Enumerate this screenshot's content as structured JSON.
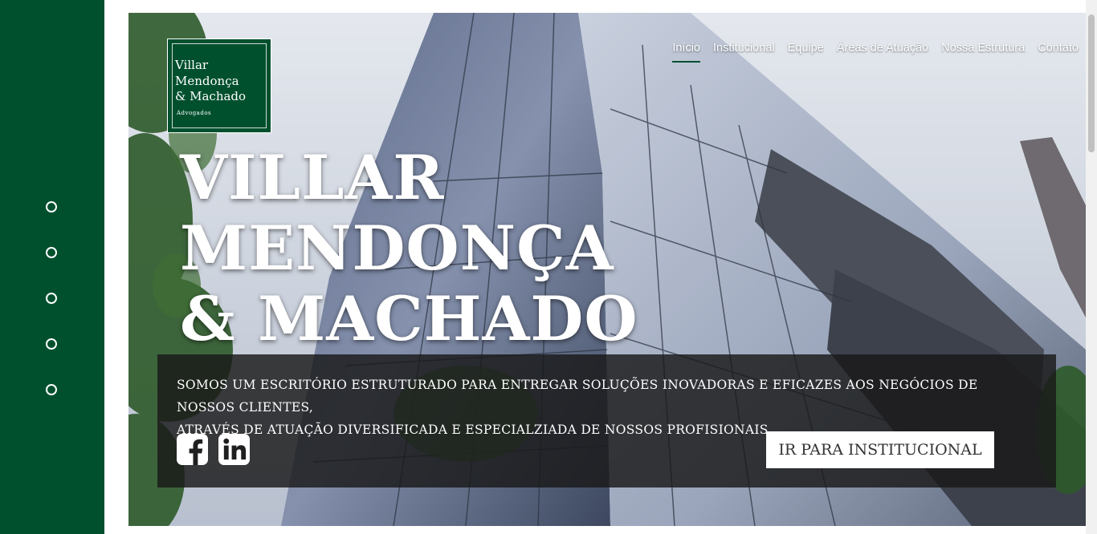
{
  "sidebar": {
    "dots": [
      "slide-1",
      "slide-2",
      "slide-3",
      "slide-4",
      "slide-5"
    ],
    "color": "#00502e"
  },
  "logo": {
    "line1": "Villar",
    "line2": "Mendonça",
    "line3": "& Machado",
    "sub": "Advogados"
  },
  "nav": {
    "items": [
      "Início",
      "Institucional",
      "Equipe",
      "Áreas de Atuação",
      "Nossa Estrutura",
      "Contato"
    ],
    "active": "Início"
  },
  "hero": {
    "title_line1": "VILLAR",
    "title_line2": "MENDONÇA",
    "title_line3": "& MACHADO",
    "description_line1": "SOMOS UM ESCRITÓRIO ESTRUTURADO PARA ENTREGAR SOLUÇÕES INOVADORAS E EFICAZES AOS NEGÓCIOS DE NOSSOS CLIENTES,",
    "description_line2": "ATRAVÉS DE ATUAÇÃO DIVERSIFICADA E ESPECIALZIADA DE NOSSOS PROFISIONAIS.",
    "cta_label": "IR PARA INSTITUCIONAL"
  },
  "social": {
    "icons": [
      "facebook-icon",
      "linkedin-icon"
    ]
  }
}
